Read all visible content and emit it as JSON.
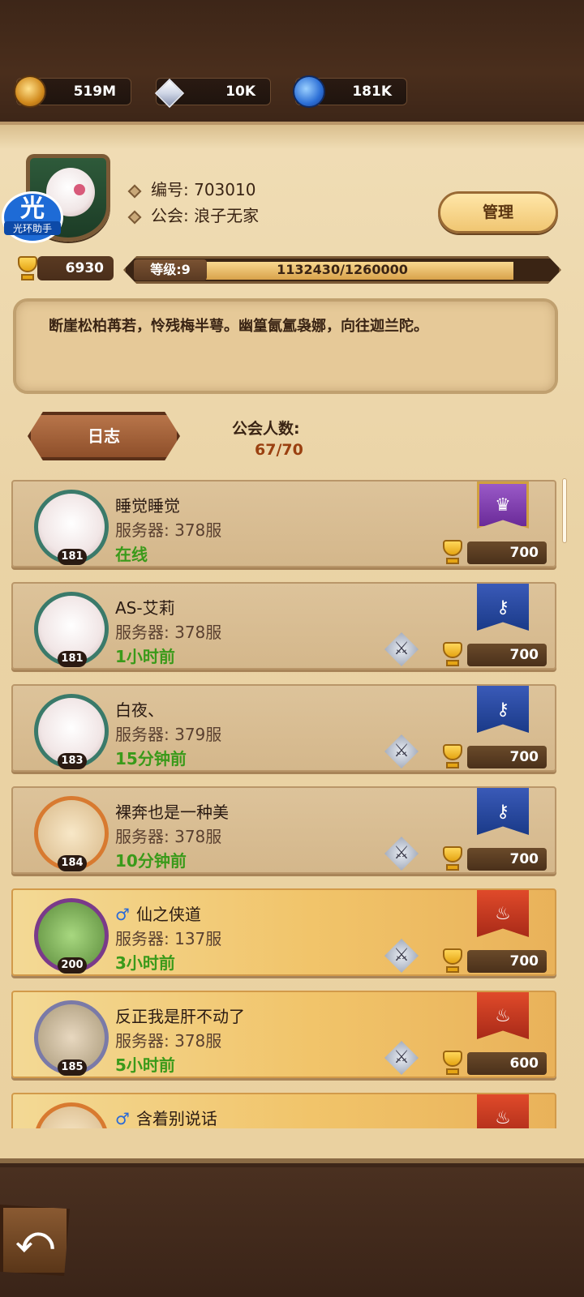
{
  "resources": {
    "coins": "519M",
    "diamonds": "10K",
    "gems": "181K"
  },
  "watermark": {
    "char": "光",
    "label": "光环助手"
  },
  "guild": {
    "id_text": "编号: 703010",
    "name_text": "公会: 浪子无家",
    "manage_label": "管理",
    "trophies": "6930",
    "level_label": "等级:9",
    "exp_text": "1132430/1260000",
    "exp_current": 1132430,
    "exp_max": 1260000,
    "motto": "断崖松柏苒若，怜残梅半萼。幽篁氤氲袅娜，向往迦兰陀。",
    "log_label": "日志",
    "member_count_label": "公会人数:",
    "member_count": "67/70"
  },
  "members": [
    {
      "name": "睡觉睡觉",
      "server": "服务器: 378服",
      "status": "在线",
      "level": "181",
      "score": "700",
      "rank_icon": "crown-banner",
      "gender": "",
      "swords": false
    },
    {
      "name": "AS-艾莉",
      "server": "服务器: 378服",
      "status": "1小时前",
      "level": "181",
      "score": "700",
      "rank_icon": "key-banner",
      "gender": "",
      "swords": true
    },
    {
      "name": "白夜、",
      "server": "服务器: 379服",
      "status": "15分钟前",
      "level": "183",
      "score": "700",
      "rank_icon": "key-banner",
      "gender": "",
      "swords": true
    },
    {
      "name": "裸奔也是一种美",
      "server": "服务器: 378服",
      "status": "10分钟前",
      "level": "184",
      "score": "700",
      "rank_icon": "key-banner",
      "gender": "",
      "swords": true
    },
    {
      "name": "仙之侠道",
      "server": "服务器: 137服",
      "status": "3小时前",
      "level": "200",
      "score": "700",
      "rank_icon": "flame-banner",
      "gender": "♂",
      "swords": true
    },
    {
      "name": "反正我是肝不动了",
      "server": "服务器: 378服",
      "status": "5小时前",
      "level": "185",
      "score": "600",
      "rank_icon": "flame-banner",
      "gender": "",
      "swords": true
    },
    {
      "name": "含着别说话",
      "server": "",
      "status": "",
      "level": "",
      "score": "",
      "rank_icon": "flame-banner",
      "gender": "♂",
      "swords": false
    }
  ],
  "colors": {
    "online": "#3a9a1a",
    "accent_brown": "#7b5a36",
    "parchment": "#ead3a5"
  },
  "back_icon": "back-arrow-icon"
}
